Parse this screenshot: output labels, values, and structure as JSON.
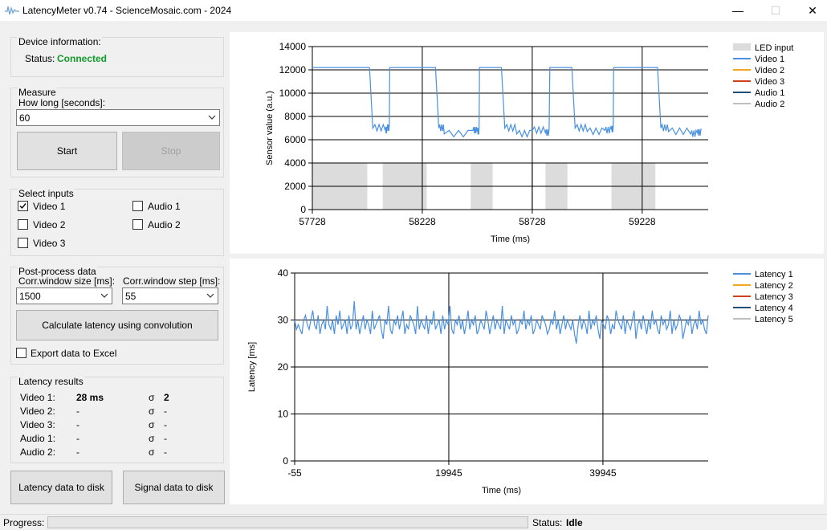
{
  "window": {
    "title": "LatencyMeter v0.74 - ScienceMosaic.com - 2024",
    "minimize": "—",
    "maximize": "☐",
    "close": "✕"
  },
  "device": {
    "group": "Device information:",
    "status_label": "Status:",
    "status_value": "Connected",
    "status_color": "#119a2a"
  },
  "measure": {
    "group": "Measure",
    "how_long_label": "How long [seconds]:",
    "how_long_value": "60",
    "start": "Start",
    "stop": "Stop"
  },
  "inputs": {
    "group": "Select inputs",
    "items": [
      {
        "label": "Video 1",
        "checked": true
      },
      {
        "label": "Video 2",
        "checked": false
      },
      {
        "label": "Video 3",
        "checked": false
      },
      {
        "label": "Audio 1",
        "checked": false
      },
      {
        "label": "Audio 2",
        "checked": false
      }
    ]
  },
  "postprocess": {
    "group": "Post-process data",
    "size_label": "Corr.window size [ms]:",
    "size_value": "1500",
    "step_label": "Corr.window step [ms]:",
    "step_value": "55",
    "calculate": "Calculate latency using convolution",
    "export": "Export data to Excel"
  },
  "results": {
    "group": "Latency results",
    "sigma": "σ",
    "rows": [
      {
        "name": "Video 1:",
        "value": "28 ms",
        "sigma": "2"
      },
      {
        "name": "Video 2:",
        "value": "-",
        "sigma": "-"
      },
      {
        "name": "Video 3:",
        "value": "-",
        "sigma": "-"
      },
      {
        "name": "Audio 1:",
        "value": "-",
        "sigma": "-"
      },
      {
        "name": "Audio 2:",
        "value": "-",
        "sigma": "-"
      }
    ]
  },
  "actions": {
    "latency_to_disk": "Latency data to disk",
    "signal_to_disk": "Signal data to disk"
  },
  "statusbar": {
    "progress_label": "Progress:",
    "progress": 0,
    "status_label": "Status:",
    "status_value": "Idle"
  },
  "chart_data": [
    {
      "type": "line",
      "xlabel": "Time (ms)",
      "ylabel": "Sensor value (a.u.)",
      "xlim": [
        57728,
        59528
      ],
      "ylim": [
        0,
        14000
      ],
      "x_ticks": [
        "57728",
        "58228",
        "58728",
        "59228"
      ],
      "y_ticks": [
        "0",
        "2000",
        "4000",
        "6000",
        "8000",
        "10000",
        "12000",
        "14000"
      ],
      "grid": true,
      "legend_position": "right",
      "legend": [
        {
          "name": "LED input",
          "color": "#dcdcdc",
          "kind": "box"
        },
        {
          "name": "Video 1",
          "color": "#4a90e2",
          "kind": "line"
        },
        {
          "name": "Video 2",
          "color": "#f5a623",
          "kind": "line"
        },
        {
          "name": "Video 3",
          "color": "#d0421b",
          "kind": "line"
        },
        {
          "name": "Audio 1",
          "color": "#1f4e79",
          "kind": "line"
        },
        {
          "name": "Audio 2",
          "color": "#bfbfbf",
          "kind": "line"
        }
      ],
      "led_input": {
        "level": 4000,
        "pulses": [
          [
            57728,
            57978
          ],
          [
            58048,
            58248
          ],
          [
            58448,
            58548
          ],
          [
            58788,
            58888
          ],
          [
            59088,
            59288
          ]
        ]
      },
      "series": [
        {
          "name": "Video 1",
          "high": 12200,
          "low": 6800,
          "points": [
            [
              57728,
              12200
            ],
            [
              57988,
              12200
            ],
            [
              58003,
              7000
            ],
            [
              58060,
              6800
            ],
            [
              58068,
              7000
            ],
            [
              58080,
              12200
            ],
            [
              58288,
              12200
            ],
            [
              58303,
              7000
            ],
            [
              58328,
              6500
            ],
            [
              58458,
              6800
            ],
            [
              58478,
              6700
            ],
            [
              58488,
              12200
            ],
            [
              58588,
              12200
            ],
            [
              58603,
              7000
            ],
            [
              58658,
              6500
            ],
            [
              58728,
              6800
            ],
            [
              58788,
              6600
            ],
            [
              58808,
              12200
            ],
            [
              58908,
              12200
            ],
            [
              58923,
              7000
            ],
            [
              58978,
              6700
            ],
            [
              59058,
              6800
            ],
            [
              59088,
              6900
            ],
            [
              59098,
              12200
            ],
            [
              59298,
              12200
            ],
            [
              59313,
              7000
            ],
            [
              59348,
              6700
            ],
            [
              59448,
              6500
            ],
            [
              59478,
              6600
            ],
            [
              59498,
              6900
            ]
          ]
        }
      ]
    },
    {
      "type": "line",
      "xlabel": "Time (ms)",
      "ylabel": "Latency [ms]",
      "xlim": [
        -55,
        53600
      ],
      "ylim": [
        0,
        40
      ],
      "x_ticks": [
        "-55",
        "19945",
        "39945"
      ],
      "y_ticks": [
        "0",
        "10",
        "20",
        "30",
        "40"
      ],
      "grid": true,
      "legend_position": "right",
      "legend": [
        {
          "name": "Latency 1",
          "color": "#4a90e2"
        },
        {
          "name": "Latency 2",
          "color": "#f5a623"
        },
        {
          "name": "Latency 3",
          "color": "#d0421b"
        },
        {
          "name": "Latency 4",
          "color": "#1f4e79"
        },
        {
          "name": "Latency 5",
          "color": "#bfbfbf"
        }
      ],
      "series": [
        {
          "name": "Latency 1",
          "mean": 29,
          "x_start": -55,
          "x_end": 53600,
          "values": [
            30,
            28,
            29,
            28,
            27,
            30,
            31,
            29,
            28,
            30,
            32,
            29,
            28,
            31,
            27,
            29,
            30,
            28,
            33,
            29,
            28,
            30,
            27,
            31,
            29,
            32,
            28,
            29,
            30,
            27,
            31,
            28,
            29,
            34,
            28,
            30,
            27,
            29,
            31,
            28,
            30,
            29,
            27,
            32,
            28,
            29,
            30,
            31,
            28,
            26,
            30,
            29,
            33,
            28,
            27,
            30,
            29,
            31,
            28,
            30,
            32,
            27,
            29,
            28,
            31,
            30,
            29,
            27,
            33,
            28,
            30,
            29,
            28,
            31,
            27,
            30,
            29,
            32,
            28,
            29,
            30,
            27,
            31,
            28,
            30,
            29,
            33,
            28,
            27,
            30,
            29,
            31,
            28,
            30,
            27,
            29,
            32,
            28,
            30,
            29,
            31,
            27,
            28,
            30,
            29,
            28,
            32,
            30,
            27,
            29,
            31,
            28,
            30,
            29,
            28,
            33,
            27,
            30,
            29,
            28,
            31,
            29,
            30,
            27,
            28,
            30,
            29,
            32,
            28,
            30,
            29,
            31,
            27,
            28,
            30,
            29,
            28,
            31,
            30,
            29,
            27,
            28,
            30,
            29,
            32,
            28,
            30,
            27,
            29,
            31,
            28,
            30,
            29,
            28,
            30,
            27,
            25,
            29,
            31,
            28,
            30,
            29,
            27,
            32,
            28,
            30,
            29,
            31,
            28,
            26,
            30,
            29,
            28,
            31,
            30,
            27,
            29,
            28,
            32,
            30,
            29,
            28,
            31,
            27,
            30,
            29,
            28,
            30,
            32,
            26,
            29,
            30,
            28,
            31,
            29,
            27,
            30,
            28,
            32,
            29,
            30,
            28,
            27,
            31,
            29,
            30,
            28,
            29,
            32,
            27,
            30,
            28,
            29,
            31,
            30,
            26,
            28,
            30,
            29,
            31,
            27,
            29,
            30,
            28,
            32,
            29,
            30,
            28,
            27,
            31
          ]
        }
      ]
    }
  ]
}
